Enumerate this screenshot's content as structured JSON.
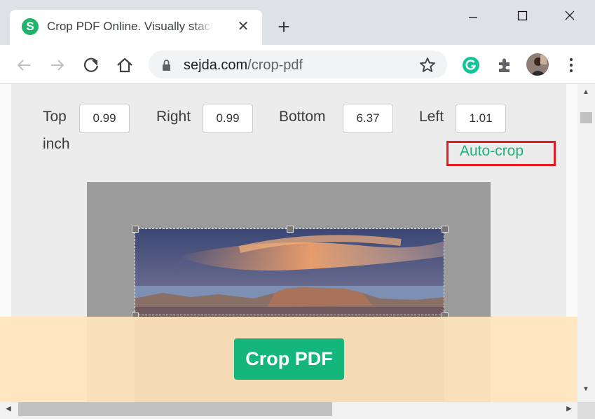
{
  "browser": {
    "tab_title": "Crop PDF Online. Visually stacked",
    "favicon_letter": "S",
    "url_domain": "sejda.com",
    "url_path": "/crop-pdf"
  },
  "crop": {
    "fields": [
      {
        "label": "Top",
        "value": "0.99"
      },
      {
        "label": "Right",
        "value": "0.99"
      },
      {
        "label": "Bottom",
        "value": "6.37"
      },
      {
        "label": "Left",
        "value": "1.01"
      }
    ],
    "unit": "inch",
    "autocrop_label": "Auto-crop"
  },
  "actions": {
    "crop_pdf_label": "Crop PDF"
  },
  "colors": {
    "accent": "#14b67c",
    "autocrop_text": "#1fb37a",
    "highlight": "#e31b23",
    "bottom_bar": "#ffe5bc"
  }
}
